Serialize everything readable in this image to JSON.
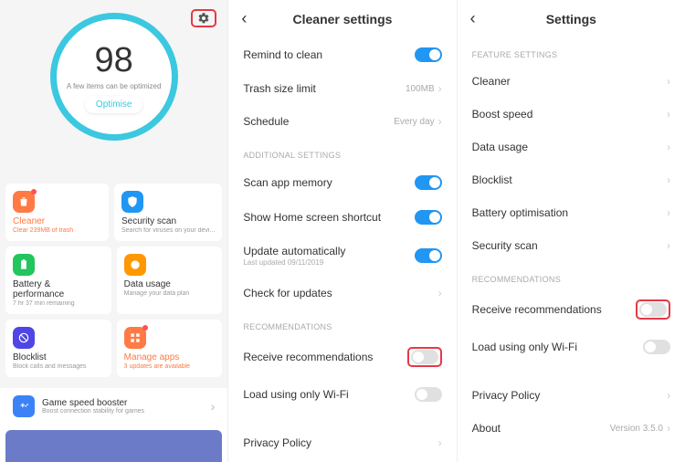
{
  "col1": {
    "score": "98",
    "score_sub": "A few items can be optimized",
    "optimise": "Optimise",
    "cards": {
      "cleaner": {
        "title": "Cleaner",
        "sub": "Clear 239MB of trash"
      },
      "security": {
        "title": "Security scan",
        "sub": "Search for viruses on your devi..."
      },
      "battery": {
        "title": "Battery & performance",
        "sub": "7 hr 37 min  remaining"
      },
      "data": {
        "title": "Data usage",
        "sub": "Manage your data plan"
      },
      "blocklist": {
        "title": "Blocklist",
        "sub": "Block calls and messages"
      },
      "manage": {
        "title": "Manage apps",
        "sub": "3 updates are available"
      }
    },
    "booster": {
      "title": "Game speed booster",
      "sub": "Boost connection stability for games"
    }
  },
  "col2": {
    "title": "Cleaner settings",
    "rows": {
      "remind": "Remind to clean",
      "trash_label": "Trash size limit",
      "trash_val": "100MB",
      "sched_label": "Schedule",
      "sched_val": "Every day",
      "sect_add": "ADDITIONAL SETTINGS",
      "scan": "Scan app memory",
      "shortcut": "Show Home screen shortcut",
      "update": "Update automatically",
      "update_sub": "Last updated 09/11/2019",
      "check": "Check for updates",
      "sect_rec": "RECOMMENDATIONS",
      "receive": "Receive recommendations",
      "wifi": "Load using only Wi-Fi",
      "privacy": "Privacy Policy"
    }
  },
  "col3": {
    "title": "Settings",
    "sect_feat": "FEATURE SETTINGS",
    "items": {
      "cleaner": "Cleaner",
      "boost": "Boost speed",
      "data": "Data usage",
      "block": "Blocklist",
      "battery": "Battery optimisation",
      "scan": "Security scan"
    },
    "sect_rec": "RECOMMENDATIONS",
    "receive": "Receive recommendations",
    "wifi": "Load using only Wi-Fi",
    "privacy": "Privacy Policy",
    "about": "About",
    "version": "Version 3.5.0"
  }
}
